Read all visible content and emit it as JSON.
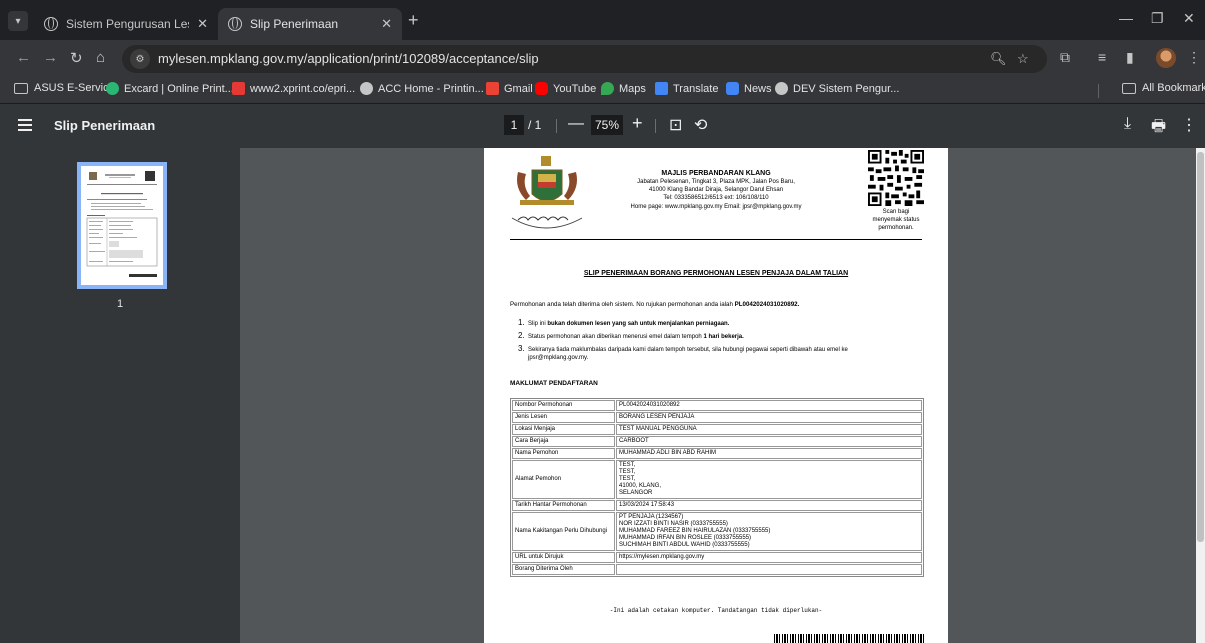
{
  "tabs": [
    {
      "title": "Sistem Pengurusan Lesen & Per",
      "active": false
    },
    {
      "title": "Slip Penerimaan",
      "active": true
    }
  ],
  "toolbar": {
    "url_host": "mylesen.mpklang.gov.my",
    "url_path": "/application/print/102089/acceptance/slip"
  },
  "bookmarks": [
    {
      "label": "ASUS E-Service",
      "icon": "folder-icon"
    },
    {
      "label": "Excard | Online Print...",
      "icon": "excard-icon",
      "color": "#2bb673"
    },
    {
      "label": "www2.xprint.co/epri...",
      "icon": "xprint-icon",
      "color": "#e53935"
    },
    {
      "label": "ACC Home - Printin...",
      "icon": "globe-icon"
    },
    {
      "label": "Gmail",
      "icon": "gmail-icon",
      "color": "#ea4335"
    },
    {
      "label": "YouTube",
      "icon": "youtube-icon",
      "color": "#ff0000"
    },
    {
      "label": "Maps",
      "icon": "maps-icon",
      "color": "#34a853"
    },
    {
      "label": "Translate",
      "icon": "translate-icon",
      "color": "#4285f4"
    },
    {
      "label": "News",
      "icon": "news-icon",
      "color": "#4285f4"
    },
    {
      "label": "DEV Sistem Pengur...",
      "icon": "globe-icon"
    }
  ],
  "all_bookmarks": "All Bookmarks",
  "pdf": {
    "title": "Slip Penerimaan",
    "page_current": "1",
    "page_total": "/ 1",
    "zoom": "75%",
    "thumb_label": "1"
  },
  "doc": {
    "org_name": "MAJLIS PERBANDARAN KLANG",
    "org_lines": [
      "Jabatan Pelesenan, Tingkat 3, Plaza MPK, Jalan Pos Baru,",
      "41000 Klang Bandar Diraja, Selangor Darul Ehsan",
      "Tel: 0333586512/6513  ext: 106/108/110",
      "Home page: www.mpklang.gov.my       Email: jpsr@mpklang.gov.my"
    ],
    "qr_caption": [
      "Scan bagi",
      "menyemak status",
      "permohonan."
    ],
    "title": "SLIP PENERIMAAN BORANG PERMOHONAN LESEN PENJAJA DALAM TALIAN",
    "intro_prefix": "Permohonan anda telah diterima oleh sistem. No rujukan permohonan anda ialah ",
    "intro_ref": "PL0042024031020892.",
    "points": [
      {
        "n": "1.",
        "pre": "Slip ini ",
        "bold": "bukan dokumen lesen yang sah untuk menjalankan perniagaan.",
        "post": ""
      },
      {
        "n": "2.",
        "pre": "Status permohonan akan diberikan menerusi emel dalam tempoh ",
        "bold": "1 hari bekerja.",
        "post": ""
      },
      {
        "n": "3.",
        "pre": "Sekiranya tiada maklumbalas daripada kami dalam tempoh tersebut, sila hubungi pegawai seperti dibawah atau emel ke",
        "bold": "",
        "post": "jpsr@mpklang.gov.my."
      }
    ],
    "section": "MAKLUMAT PENDAFTARAN",
    "rows": [
      {
        "label": "Nombor Permohonan",
        "value": [
          "PL0042024031020892"
        ]
      },
      {
        "label": "Jenis Lesen",
        "value": [
          "BORANG LESEN PENJAJA"
        ]
      },
      {
        "label": "Lokasi Menjaja",
        "value": [
          "TEST MANUAL PENGGUNA"
        ]
      },
      {
        "label": "Cara Berjaja",
        "value": [
          "CARBOOT"
        ]
      },
      {
        "label": "Nama Pemohon",
        "value": [
          "MUHAMMAD ADLI BIN ABD RAHIM"
        ]
      },
      {
        "label": "Alamat Pemohon",
        "value": [
          "TEST,",
          "TEST,",
          "TEST,",
          "41000, KLANG,",
          "SELANGOR"
        ]
      },
      {
        "label": "Tarikh Hantar Permohonan",
        "value": [
          "13/03/2024 17:58:43"
        ]
      },
      {
        "label": "Nama Kakitangan Perlu Dihubungi",
        "value": [
          "PT PENJAJA (1234567)",
          "NOR IZZATI BINTI NASIR (0333755555)",
          "MUHAMMAD FAREEZ BIN HAIRULAZAN (0333755555)",
          "MUHAMMAD IRFAN BIN ROSLEE (0333755555)",
          "SUCHIMAH BINTI ABDUL WAHID (0333755555)"
        ]
      },
      {
        "label": "URL untuk Dirujuk",
        "value": [
          "https://mylesen.mpklang.gov.my"
        ]
      },
      {
        "label": "Borang Diterima Oleh",
        "value": [
          ""
        ]
      }
    ],
    "footnote": "-Ini adalah cetakan komputer. Tandatangan tidak diperlukan-"
  }
}
